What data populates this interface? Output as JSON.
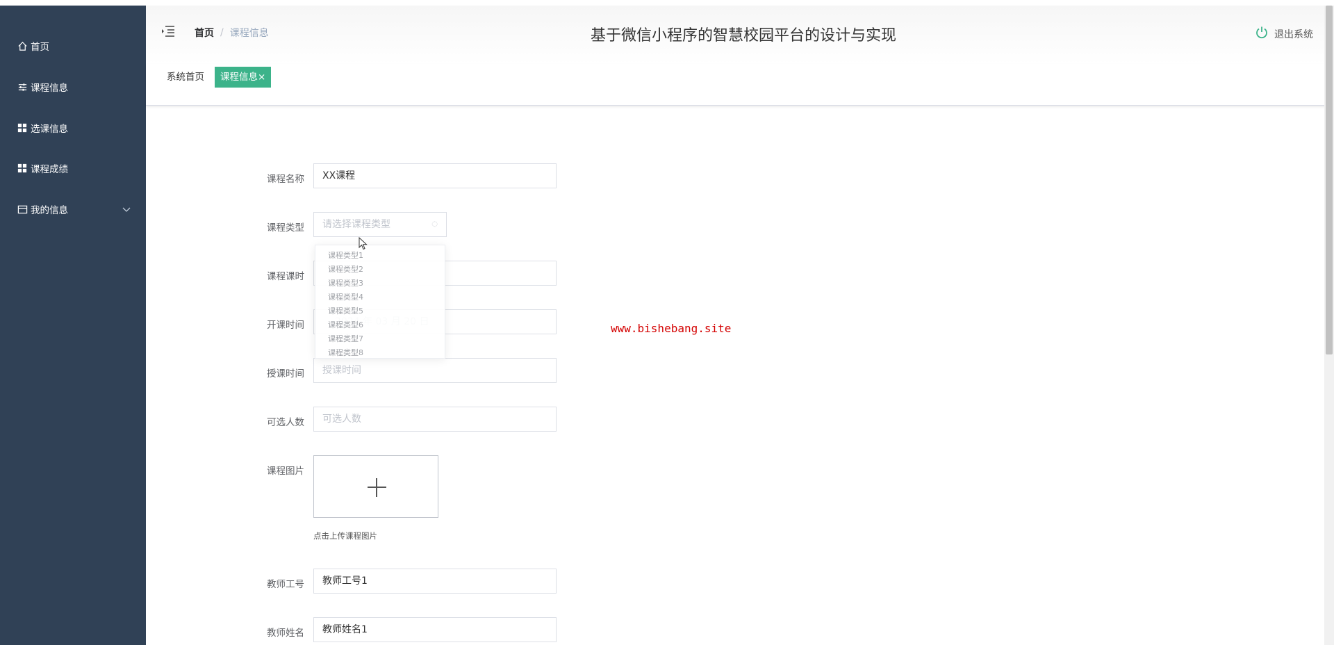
{
  "sidebar": {
    "items": [
      {
        "label": "首页",
        "icon": "home-icon"
      },
      {
        "label": "课程信息",
        "icon": "sliders-icon"
      },
      {
        "label": "选课信息",
        "icon": "grid-icon"
      },
      {
        "label": "课程成绩",
        "icon": "grid-icon"
      },
      {
        "label": "我的信息",
        "icon": "wallet-icon"
      }
    ]
  },
  "header": {
    "breadcrumb_home": "首页",
    "breadcrumb_sep": "/",
    "breadcrumb_current": "课程信息",
    "title": "基于微信小程序的智慧校园平台的设计与实现",
    "logout": "退出系统"
  },
  "tags": {
    "home": "系统首页",
    "active": "课程信息",
    "close": "×"
  },
  "form": {
    "course_name_label": "课程名称",
    "course_name_value": "XX课程",
    "course_type_label": "课程类型",
    "course_type_placeholder": "请选择课程类型",
    "course_hours_label": "课程课时",
    "start_time_label": "开课时间",
    "start_time_value": "2024 年 03 月 20 日",
    "teach_time_label": "授课时间",
    "teach_time_placeholder": "授课时间",
    "capacity_label": "可选人数",
    "capacity_placeholder": "可选人数",
    "image_label": "课程图片",
    "image_tip": "点击上传课程图片",
    "teacher_id_label": "教师工号",
    "teacher_id_value": "教师工号1",
    "teacher_name_label": "教师姓名",
    "teacher_name_value": "教师姓名1"
  },
  "dropdown": {
    "options": [
      "课程类型1",
      "课程类型2",
      "课程类型3",
      "课程类型4",
      "课程类型5",
      "课程类型6",
      "课程类型7",
      "课程类型8"
    ]
  },
  "watermark": "www.bishebang.site",
  "colors": {
    "sidebar_bg": "#304156",
    "active_tag": "#3cb38a",
    "logout_icon": "#3cb38a",
    "watermark": "#d40000"
  }
}
